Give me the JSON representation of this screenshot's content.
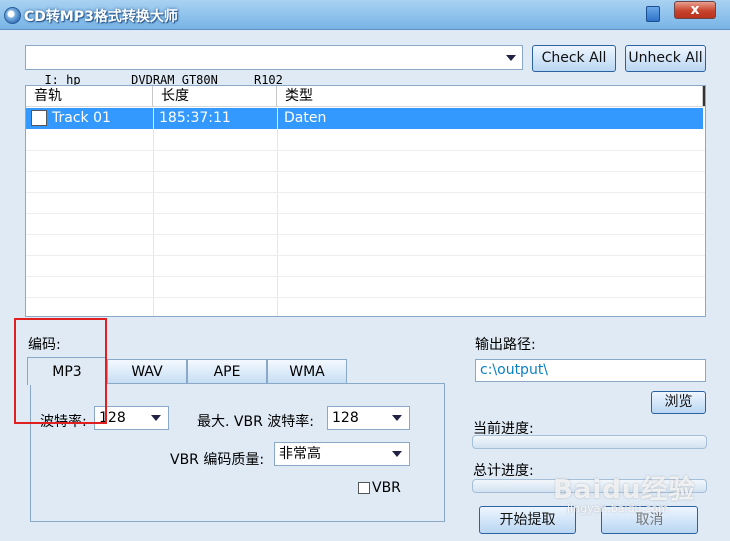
{
  "window": {
    "title": "CD转MP3格式转换大师",
    "close_label": "x"
  },
  "drive": {
    "value": "I: hp       DVDRAM GT80N     R102"
  },
  "buttons": {
    "check_all": "Check All",
    "uncheck_all": "Unheck All",
    "browse": "浏览",
    "start": "开始提取",
    "cancel": "取消"
  },
  "tracklist": {
    "columns": [
      "音轨",
      "长度",
      "类型"
    ],
    "rows": [
      {
        "track": "Track 01",
        "length": "185:37:11",
        "type": "Daten",
        "checked": false,
        "selected": true
      }
    ]
  },
  "encoding": {
    "label": "编码:",
    "tabs": [
      "MP3",
      "WAV",
      "APE",
      "WMA"
    ],
    "active_tab": "MP3",
    "bitrate_label": "波特率:",
    "bitrate_value": "128",
    "max_vbr_label": "最大. VBR 波特率:",
    "max_vbr_value": "128",
    "vbr_quality_label": "VBR 编码质量:",
    "vbr_quality_value": "非常高",
    "vbr_checkbox_label": "VBR",
    "vbr_checked": false
  },
  "output": {
    "label": "输出路径:",
    "path": "c:\\output\\"
  },
  "progress": {
    "current_label": "当前进度:",
    "total_label": "总计进度:",
    "current_value": 0,
    "total_value": 0
  },
  "watermark": {
    "text": "Baidu经验",
    "sub": "jingyan.baidu.com"
  },
  "colors": {
    "selection": "#3399ff",
    "highlight_box": "#e02020",
    "title_gradient_top": "#a9d2f2",
    "window_bg": "#dfeaf5"
  }
}
